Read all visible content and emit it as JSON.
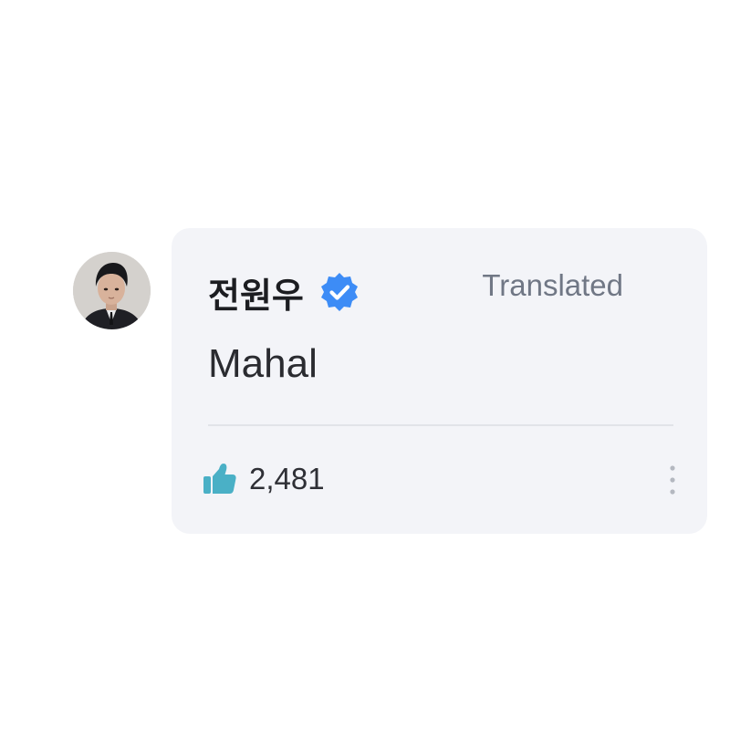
{
  "comment": {
    "author": {
      "name": "전원우",
      "verified": true,
      "avatar_icon": "profile-photo"
    },
    "translated_label": "Translated",
    "text": "Mahal",
    "likes": "2,481",
    "icons": {
      "verified": "verified-badge-icon",
      "like": "thumbs-up-icon",
      "more": "more-vertical-icon"
    },
    "colors": {
      "card_background": "#f3f4f8",
      "verified_blue": "#3d8cf6",
      "like_teal": "#4ab0c6",
      "muted_text": "#707785"
    }
  }
}
